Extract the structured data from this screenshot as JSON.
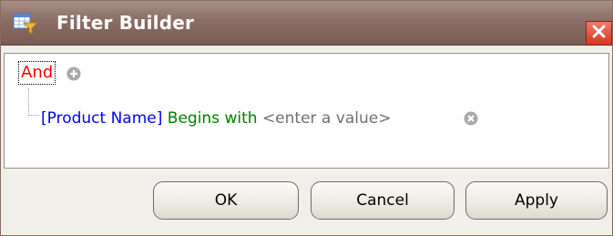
{
  "dialog": {
    "title": "Filter Builder",
    "icon": "filter-builder-icon",
    "close_icon": "close-icon"
  },
  "filter": {
    "group_operator": "And",
    "add_icon": "add-condition-icon",
    "condition": {
      "field": "[Product Name]",
      "operation": "Begins with",
      "value_placeholder": "<enter a value>",
      "remove_icon": "remove-condition-icon"
    }
  },
  "buttons": {
    "ok": "OK",
    "cancel": "Cancel",
    "apply": "Apply"
  },
  "colors": {
    "titlebar": "#8a6d63",
    "group_operator": "#ff0000",
    "field": "#0000ff",
    "operation": "#008000",
    "value": "#707070",
    "close_button": "#d8341f"
  }
}
